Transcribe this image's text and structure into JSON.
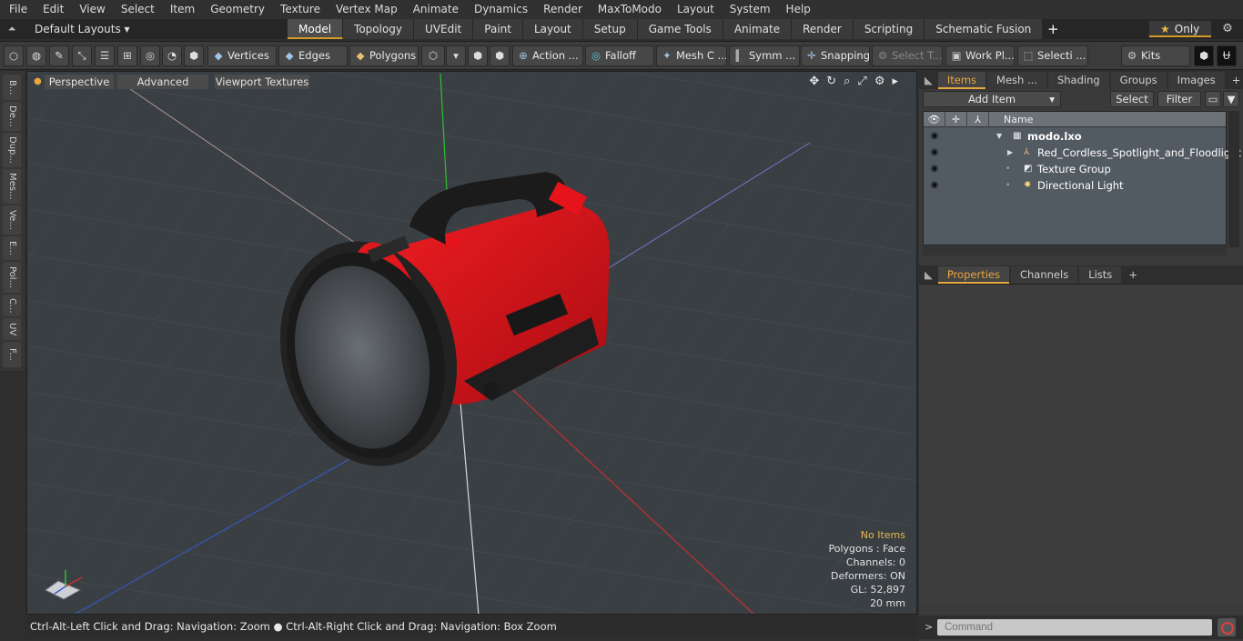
{
  "menu": [
    "File",
    "Edit",
    "View",
    "Select",
    "Item",
    "Geometry",
    "Texture",
    "Vertex Map",
    "Animate",
    "Dynamics",
    "Render",
    "MaxToModo",
    "Layout",
    "System",
    "Help"
  ],
  "layout": {
    "selector": "Default Layouts ▾",
    "tabs": [
      "Model",
      "Topology",
      "UVEdit",
      "Paint",
      "Layout",
      "Setup",
      "Game Tools",
      "Animate",
      "Render",
      "Scripting",
      "Schematic Fusion"
    ],
    "active_tab": "Model",
    "only_label": "Only"
  },
  "toolbar": {
    "vertices": "Vertices",
    "edges": "Edges",
    "polygons": "Polygons",
    "action": "Action ...",
    "falloff": "Falloff",
    "mesh": "Mesh C ...",
    "symm": "Symm ...",
    "snapping": "Snapping",
    "select_t": "Select T...",
    "work_pl": "Work Pl...",
    "selecti": "Selecti ...",
    "kits": "Kits"
  },
  "left_tabs": [
    "B...",
    "De...",
    "Dup...",
    "Mes...",
    "Ve...",
    "E...",
    "Pol...",
    "C...",
    "UV",
    "F..."
  ],
  "viewport": {
    "perspective": "Perspective",
    "advanced": "Advanced",
    "textures": "Viewport Textures",
    "info": {
      "no_items": "No Items",
      "polygons": "Polygons : Face",
      "channels": "Channels: 0",
      "deformers": "Deformers: ON",
      "gl": "GL: 52,897",
      "scale": "20 mm"
    }
  },
  "status": "Ctrl-Alt-Left Click and Drag: Navigation: Zoom ● Ctrl-Alt-Right Click and Drag: Navigation: Box Zoom",
  "items_panel": {
    "tabs": [
      "Items",
      "Mesh ...",
      "Shading",
      "Groups",
      "Images"
    ],
    "active": "Items",
    "add_item": "Add Item",
    "select": "Select",
    "filter": "Filter",
    "column_name": "Name",
    "rows": [
      {
        "label": "modo.lxo",
        "icon": "scene-icon"
      },
      {
        "label": "Red_Cordless_Spotlight_and_Floodlight",
        "icon": "mesh-group-icon"
      },
      {
        "label": "Texture Group",
        "icon": "texture-group-icon"
      },
      {
        "label": "Directional Light",
        "icon": "light-icon"
      }
    ]
  },
  "properties_panel": {
    "tabs": [
      "Properties",
      "Channels",
      "Lists"
    ],
    "active": "Properties"
  },
  "command": {
    "placeholder": "Command"
  },
  "colors": {
    "accent": "#e8a640",
    "body_red": "#d8141a",
    "viewport_bg": "#3a3f44"
  }
}
